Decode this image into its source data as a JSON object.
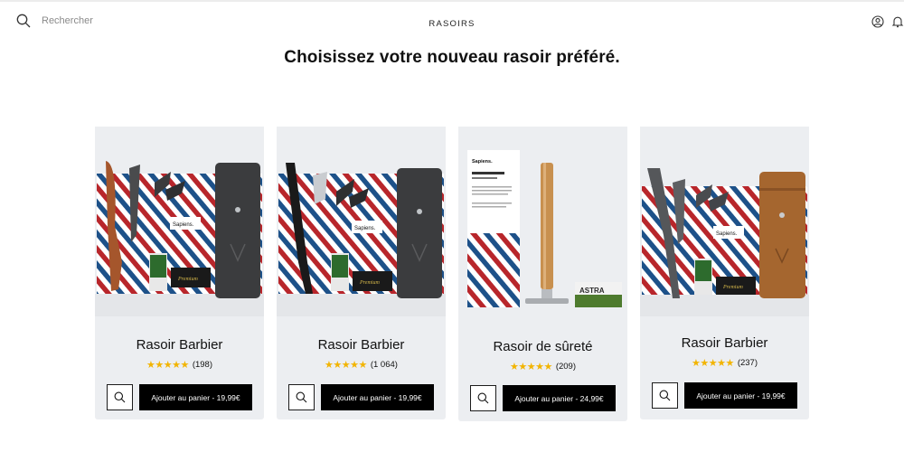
{
  "header": {
    "search_placeholder": "Rechercher",
    "title": "RASOIRS",
    "icons": [
      "user-icon",
      "bell-icon"
    ]
  },
  "headline": "Choisissez votre nouveau rasoir préféré.",
  "colors": {
    "star": "#f2b400",
    "button": "#000000",
    "card_bg": "#eceef1"
  },
  "products": [
    {
      "name": "Rasoir Barbier",
      "rating": 4.5,
      "reviews": "(198)",
      "cta": "Ajouter au panier - 19,99€"
    },
    {
      "name": "Rasoir Barbier",
      "rating": 4.5,
      "reviews": "(1 064)",
      "cta": "Ajouter au panier - 19,99€"
    },
    {
      "name": "Rasoir de sûreté",
      "rating": 4.5,
      "reviews": "(209)",
      "cta": "Ajouter au panier - 24,99€"
    },
    {
      "name": "Rasoir Barbier",
      "rating": 4.5,
      "reviews": "(237)",
      "cta": "Ajouter au panier - 19,99€"
    }
  ]
}
